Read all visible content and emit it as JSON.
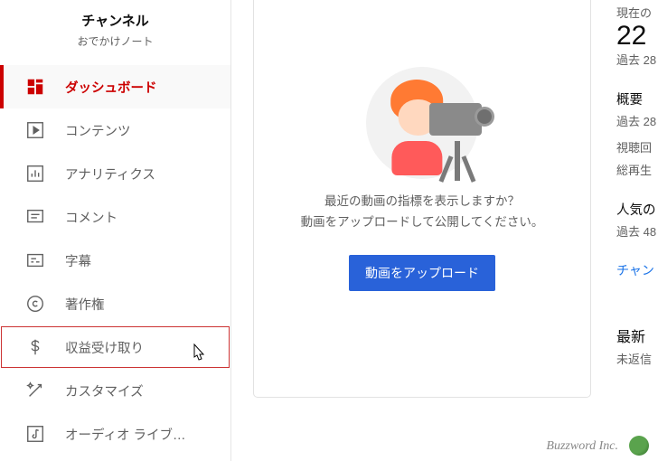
{
  "sidebar": {
    "channel_label": "チャンネル",
    "channel_name": "おでかけノート",
    "items": [
      {
        "label": "ダッシュボード"
      },
      {
        "label": "コンテンツ"
      },
      {
        "label": "アナリティクス"
      },
      {
        "label": "コメント"
      },
      {
        "label": "字幕"
      },
      {
        "label": "著作権"
      },
      {
        "label": "収益受け取り"
      },
      {
        "label": "カスタマイズ"
      },
      {
        "label": "オーディオ ライブ…"
      }
    ]
  },
  "main": {
    "prompt_line1": "最近の動画の指標を表示しますか？",
    "prompt_line2": "動画をアップロードして公開してください。",
    "upload_button": "動画をアップロード"
  },
  "right": {
    "subscribers_label": "現在の",
    "subscribers_count": "22",
    "subscribers_period": "過去 28",
    "overview_label": "概要",
    "overview_period": "過去 28",
    "views_label": "視聴回",
    "watch_label": "総再生",
    "popular_label": "人気の",
    "popular_period": "過去 48",
    "analytics_link": "チャン",
    "news_label": "最新",
    "news_sub": "未返信"
  },
  "footer": {
    "brand": "Buzzword Inc."
  }
}
